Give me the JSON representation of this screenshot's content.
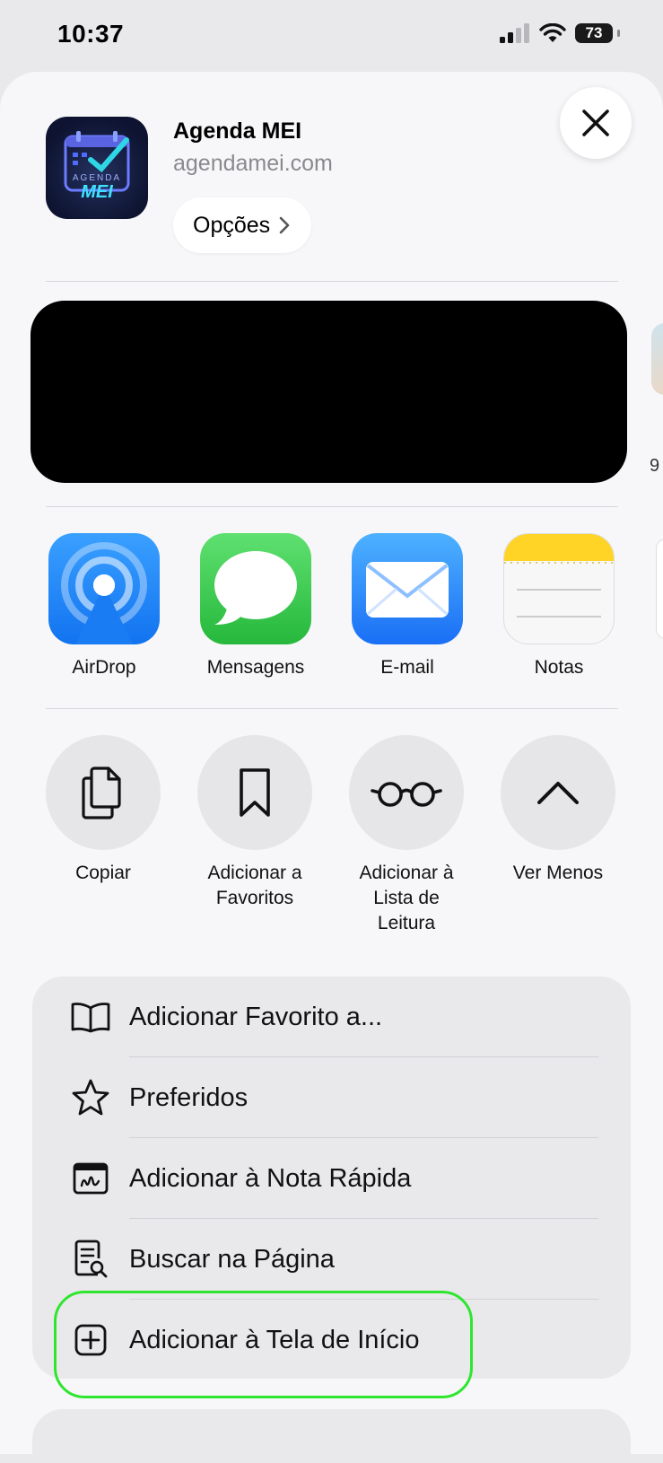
{
  "status_bar": {
    "time": "10:37",
    "battery": "73"
  },
  "header": {
    "app_name": "Agenda MEI",
    "url": "agendamei.com",
    "options_label": "Opções",
    "logo_text_top": "AGENDA",
    "logo_text_main": "MEI"
  },
  "edge_partial_text": "9",
  "apps": [
    {
      "label": "AirDrop",
      "icon": "airdrop-icon"
    },
    {
      "label": "Mensagens",
      "icon": "messages-icon"
    },
    {
      "label": "E-mail",
      "icon": "mail-icon"
    },
    {
      "label": "Notas",
      "icon": "notes-icon"
    }
  ],
  "actions": [
    {
      "label": "Copiar",
      "icon": "copy-icon"
    },
    {
      "label": "Adicionar a Favoritos",
      "icon": "bookmark-icon"
    },
    {
      "label": "Adicionar à Lista de Leitura",
      "icon": "glasses-icon"
    },
    {
      "label": "Ver Menos",
      "icon": "chevron-up-icon"
    }
  ],
  "menu": [
    {
      "label": "Adicionar Favorito a...",
      "icon": "book-icon"
    },
    {
      "label": "Preferidos",
      "icon": "star-icon"
    },
    {
      "label": "Adicionar à Nota Rápida",
      "icon": "quick-note-icon"
    },
    {
      "label": "Buscar na Página",
      "icon": "find-on-page-icon"
    },
    {
      "label": "Adicionar à Tela de Início",
      "icon": "add-square-icon"
    }
  ],
  "colors": {
    "highlight": "#2fe62f",
    "sheet": "#f7f7f9"
  }
}
